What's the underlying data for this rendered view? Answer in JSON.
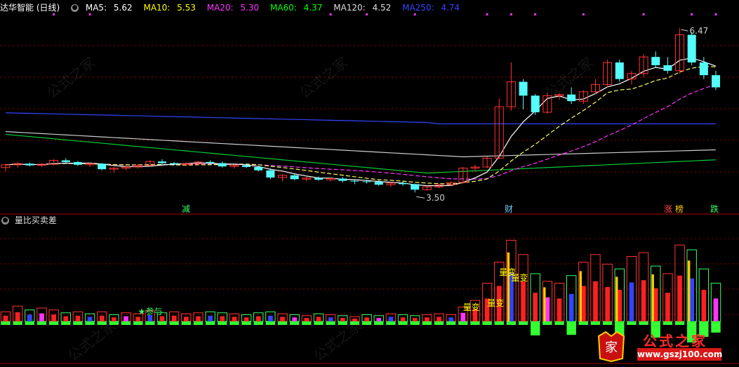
{
  "header": {
    "title": "达华智能 (日线)",
    "ma": [
      {
        "label": "MA5:",
        "value": "5.62",
        "color": "#ffffff"
      },
      {
        "label": "MA10:",
        "value": "5.53",
        "color": "#ffff00"
      },
      {
        "label": "MA20:",
        "value": "5.30",
        "color": "#ff33ff"
      },
      {
        "label": "MA60:",
        "value": "4.37",
        "color": "#00ff00"
      },
      {
        "label": "MA120:",
        "value": "4.52",
        "color": "#dddddd"
      },
      {
        "label": "MA250:",
        "value": "4.74",
        "color": "#3344ff"
      }
    ]
  },
  "indicator": {
    "title": "量比买卖差",
    "labels": {
      "tag1": "★参与",
      "tag2": "量变",
      "tag3": "量变",
      "tag4": "量变",
      "tag5": "量变"
    }
  },
  "price": {
    "high_label": "6.47",
    "low_label": "3.50",
    "events": [
      {
        "text": "减",
        "color": "#33ff66"
      },
      {
        "text": "财",
        "color": "#66ccff"
      },
      {
        "text": "涨",
        "color": "#ff4444"
      },
      {
        "text": "榜",
        "color": "#ffcc00"
      },
      {
        "text": "跌",
        "color": "#33ff66"
      }
    ]
  },
  "watermarks": [
    "公式之家",
    "www.gszj100.com"
  ],
  "logo": {
    "title": "公式之家",
    "url": "www.gszj100.com",
    "seal": "家"
  },
  "colors": {
    "up": "#ff3333",
    "down": "#54fcfc",
    "grid": "#990000"
  },
  "chart_data": {
    "type": "candlestick",
    "title": "达华智能 (日线)",
    "ylim": [
      3.3,
      6.7
    ],
    "candles": [
      [
        3.95,
        4.02,
        3.88,
        4.0
      ],
      [
        4.0,
        4.05,
        3.95,
        4.02
      ],
      [
        4.02,
        4.04,
        3.97,
        3.99
      ],
      [
        3.99,
        4.03,
        3.96,
        4.01
      ],
      [
        4.01,
        4.1,
        3.99,
        4.08
      ],
      [
        4.08,
        4.12,
        4.03,
        4.05
      ],
      [
        4.05,
        4.07,
        3.98,
        4.0
      ],
      [
        4.0,
        4.04,
        3.96,
        4.02
      ],
      [
        4.02,
        4.03,
        3.9,
        3.92
      ],
      [
        3.92,
        3.96,
        3.86,
        3.94
      ],
      [
        3.94,
        3.98,
        3.9,
        3.96
      ],
      [
        3.96,
        4.01,
        3.93,
        3.99
      ],
      [
        3.99,
        4.08,
        3.97,
        4.06
      ],
      [
        4.06,
        4.1,
        4.0,
        4.03
      ],
      [
        4.03,
        4.05,
        3.99,
        4.01
      ],
      [
        4.01,
        4.04,
        3.97,
        4.02
      ],
      [
        4.02,
        4.07,
        3.99,
        4.05
      ],
      [
        4.05,
        4.08,
        4.0,
        4.03
      ],
      [
        4.03,
        4.06,
        3.95,
        3.97
      ],
      [
        3.97,
        4.01,
        3.93,
        3.99
      ],
      [
        3.99,
        4.02,
        3.94,
        3.96
      ],
      [
        3.96,
        3.98,
        3.88,
        3.9
      ],
      [
        3.9,
        3.94,
        3.74,
        3.77
      ],
      [
        3.77,
        3.83,
        3.7,
        3.81
      ],
      [
        3.81,
        3.84,
        3.72,
        3.74
      ],
      [
        3.74,
        3.78,
        3.7,
        3.76
      ],
      [
        3.76,
        3.79,
        3.71,
        3.73
      ],
      [
        3.73,
        3.77,
        3.7,
        3.75
      ],
      [
        3.75,
        3.78,
        3.68,
        3.71
      ],
      [
        3.71,
        3.74,
        3.65,
        3.7
      ],
      [
        3.7,
        3.73,
        3.66,
        3.69
      ],
      [
        3.69,
        3.72,
        3.62,
        3.64
      ],
      [
        3.64,
        3.69,
        3.6,
        3.67
      ],
      [
        3.67,
        3.7,
        3.62,
        3.65
      ],
      [
        3.65,
        3.66,
        3.5,
        3.55
      ],
      [
        3.55,
        3.62,
        3.53,
        3.6
      ],
      [
        3.6,
        3.66,
        3.58,
        3.64
      ],
      [
        3.64,
        3.7,
        3.62,
        3.68
      ],
      [
        3.68,
        3.96,
        3.66,
        3.94
      ],
      [
        3.94,
        4.0,
        3.88,
        3.96
      ],
      [
        3.96,
        4.15,
        3.94,
        4.12
      ],
      [
        4.12,
        5.2,
        4.1,
        5.05
      ],
      [
        5.05,
        5.85,
        4.98,
        5.5
      ],
      [
        5.5,
        5.55,
        5.0,
        5.25
      ],
      [
        5.25,
        5.28,
        4.9,
        4.95
      ],
      [
        4.95,
        5.3,
        4.92,
        5.25
      ],
      [
        5.25,
        5.3,
        5.18,
        5.27
      ],
      [
        5.27,
        5.4,
        5.1,
        5.15
      ],
      [
        5.15,
        5.35,
        5.1,
        5.32
      ],
      [
        5.32,
        5.55,
        5.28,
        5.45
      ],
      [
        5.45,
        5.9,
        5.4,
        5.85
      ],
      [
        5.85,
        5.9,
        5.5,
        5.55
      ],
      [
        5.55,
        5.7,
        5.45,
        5.65
      ],
      [
        5.65,
        6.0,
        5.58,
        5.95
      ],
      [
        5.95,
        6.05,
        5.75,
        5.8
      ],
      [
        5.8,
        5.95,
        5.65,
        5.7
      ],
      [
        5.7,
        6.47,
        5.65,
        6.35
      ],
      [
        6.35,
        6.4,
        5.8,
        5.85
      ],
      [
        5.85,
        5.95,
        5.55,
        5.62
      ],
      [
        5.62,
        5.7,
        5.35,
        5.4
      ]
    ],
    "volume": [
      [
        0.1,
        1
      ],
      [
        0.16,
        1
      ],
      [
        0.12,
        -1
      ],
      [
        0.14,
        1
      ],
      [
        0.12,
        1
      ],
      [
        0.09,
        -1
      ],
      [
        0.1,
        1
      ],
      [
        0.08,
        -1
      ],
      [
        0.1,
        1
      ],
      [
        0.07,
        -1
      ],
      [
        0.09,
        1
      ],
      [
        0.08,
        1
      ],
      [
        0.11,
        1
      ],
      [
        0.09,
        -1
      ],
      [
        0.1,
        1
      ],
      [
        0.08,
        1
      ],
      [
        0.09,
        1
      ],
      [
        0.1,
        -1
      ],
      [
        0.09,
        -1
      ],
      [
        0.08,
        1
      ],
      [
        0.07,
        -1
      ],
      [
        0.09,
        -1
      ],
      [
        0.1,
        -1
      ],
      [
        0.08,
        1
      ],
      [
        0.07,
        -1
      ],
      [
        0.06,
        1
      ],
      [
        0.08,
        -1
      ],
      [
        0.07,
        1
      ],
      [
        0.06,
        -1
      ],
      [
        0.05,
        1
      ],
      [
        0.07,
        -1
      ],
      [
        0.06,
        -1
      ],
      [
        0.08,
        1
      ],
      [
        0.07,
        -1
      ],
      [
        0.06,
        -1
      ],
      [
        0.07,
        1
      ],
      [
        0.08,
        1
      ],
      [
        0.07,
        1
      ],
      [
        0.15,
        1
      ],
      [
        0.22,
        1
      ],
      [
        0.4,
        1
      ],
      [
        0.62,
        1
      ],
      [
        0.85,
        1
      ],
      [
        0.7,
        1
      ],
      [
        0.5,
        -1
      ],
      [
        0.42,
        1
      ],
      [
        0.4,
        1
      ],
      [
        0.48,
        -1
      ],
      [
        0.62,
        1
      ],
      [
        0.7,
        1
      ],
      [
        0.6,
        1
      ],
      [
        0.55,
        -1
      ],
      [
        0.68,
        1
      ],
      [
        0.72,
        1
      ],
      [
        0.58,
        -1
      ],
      [
        0.5,
        1
      ],
      [
        0.8,
        1
      ],
      [
        0.75,
        -1
      ],
      [
        0.55,
        -1
      ],
      [
        0.4,
        -1
      ]
    ]
  }
}
